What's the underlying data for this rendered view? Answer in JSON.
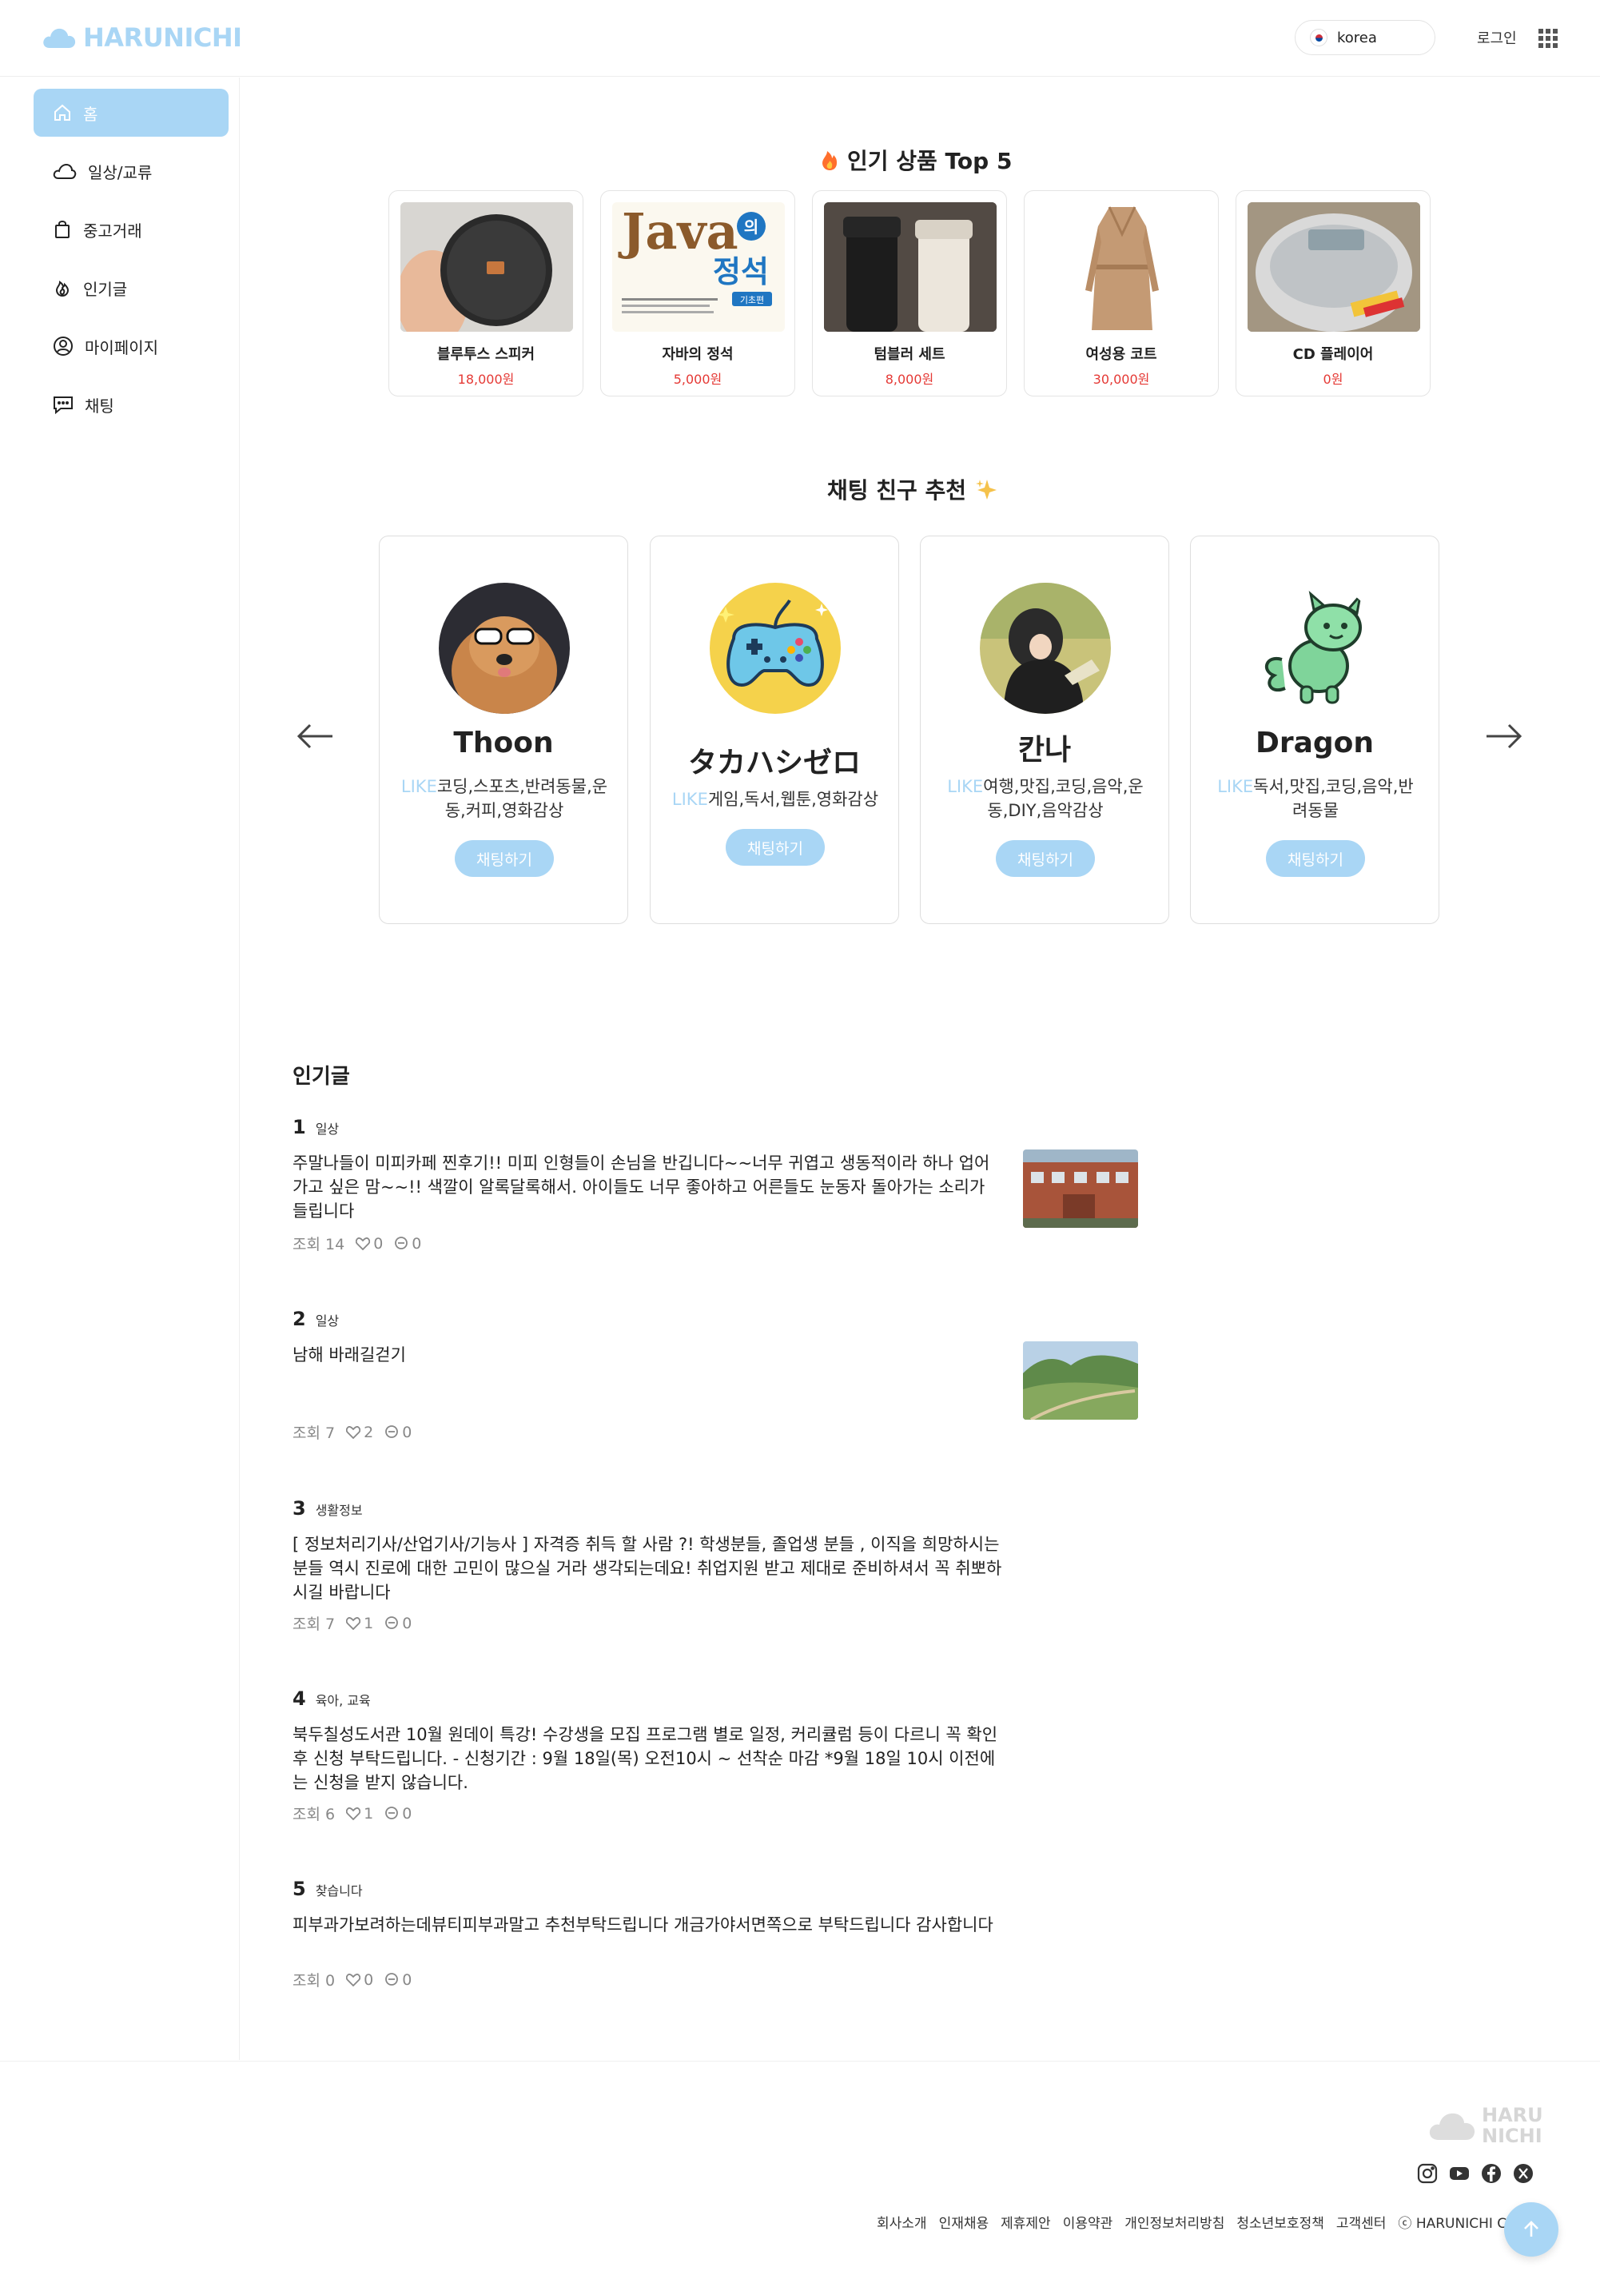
{
  "header": {
    "logo": "HARUNICHI",
    "country": "korea",
    "login": "로그인"
  },
  "sidebar": {
    "items": [
      {
        "label": "홈",
        "icon": "home-icon",
        "active": true
      },
      {
        "label": "일상/교류",
        "icon": "cloud-icon"
      },
      {
        "label": "중고거래",
        "icon": "shopping-bag-icon"
      },
      {
        "label": "인기글",
        "icon": "flame-icon"
      },
      {
        "label": "마이페이지",
        "icon": "user-circle-icon"
      },
      {
        "label": "채팅",
        "icon": "chat-icon"
      }
    ]
  },
  "popular_products": {
    "title": "인기 상품 Top 5",
    "items": [
      {
        "name": "블루투스 스피커",
        "price": "18,000원"
      },
      {
        "name": "자바의 정석",
        "price": "5,000원",
        "cover_title": "Java",
        "cover_sub": "의",
        "cover_title2": "정석",
        "cover_badge": "기초편"
      },
      {
        "name": "텀블러 세트",
        "price": "8,000원"
      },
      {
        "name": "여성용 코트",
        "price": "30,000원"
      },
      {
        "name": "CD 플레이어",
        "price": "0원"
      }
    ]
  },
  "friends": {
    "title": "채팅 친구 추천",
    "like_tag": "LIKE",
    "button": "채팅하기",
    "items": [
      {
        "name": "Thoon",
        "likes": "코딩,스포츠,반려동물,운동,커피,영화감상"
      },
      {
        "name": "タカハシゼロ",
        "likes": "게임,독서,웹툰,영화감상"
      },
      {
        "name": "칸나",
        "likes": "여행,맛집,코딩,음악,운동,DIY,음악감상"
      },
      {
        "name": "Dragon",
        "likes": "독서,맛집,코딩,음악,반려동물"
      }
    ]
  },
  "popular_posts": {
    "title": "인기글",
    "items": [
      {
        "rank": "1",
        "category": "일상",
        "text": "주말나들이 미피카페 찐후기!! 미피 인형들이 손님을 반깁니다~~너무 귀엽고 생동적이라 하나 업어가고 싶은 맘~~!! 색깔이 알록달록해서. 아이들도 너무 좋아하고 어른들도 눈동자 돌아가는 소리가 들립니다",
        "views": "조회 14",
        "likes": "0",
        "comments": "0"
      },
      {
        "rank": "2",
        "category": "일상",
        "text": "남해 바래길걷기",
        "views": "조회 7",
        "likes": "2",
        "comments": "0"
      },
      {
        "rank": "3",
        "category": "생활정보",
        "text": "[ 정보처리기사/산업기사/기능사 ] 자격증 취득 할 사람 ?! 학생분들, 졸업생 분들 , 이직을 희망하시는 분들 역시 진로에 대한 고민이 많으실 거라 생각되는데요! 취업지원 받고 제대로 준비하셔서 꼭 취뽀하시길 바랍니다",
        "views": "조회 7",
        "likes": "1",
        "comments": "0"
      },
      {
        "rank": "4",
        "category": "육아, 교육",
        "text": "북두칠성도서관 10월 원데이 특강! 수강생을 모집 프로그램 별로 일정, 커리큘럼 등이 다르니 꼭 확인 후 신청 부탁드립니다. - 신청기간 : 9월 18일(목) 오전10시 ~ 선착순 마감 *9월 18일 10시 이전에는 신청을 받지 않습니다.",
        "views": "조회 6",
        "likes": "1",
        "comments": "0"
      },
      {
        "rank": "5",
        "category": "찾습니다",
        "text": "피부과가보려하는데뷰티피부과말고 추천부탁드립니다 개금가야서면쪽으로 부탁드립니다 감사합니다",
        "views": "조회 0",
        "likes": "0",
        "comments": "0"
      }
    ]
  },
  "footer": {
    "logo_line1": "HARU",
    "logo_line2": "NICHI",
    "social": [
      "instagram-icon",
      "youtube-icon",
      "facebook-icon",
      "x-icon"
    ],
    "links": [
      "회사소개",
      "인재채용",
      "제휴제안",
      "이용약관",
      "개인정보처리방침",
      "청소년보호정책",
      "고객센터"
    ],
    "copyright": "ⓒ HARUNICHI C"
  },
  "colors": {
    "accent": "#a9d6f5",
    "price": "#e53935",
    "muted": "#888888"
  }
}
